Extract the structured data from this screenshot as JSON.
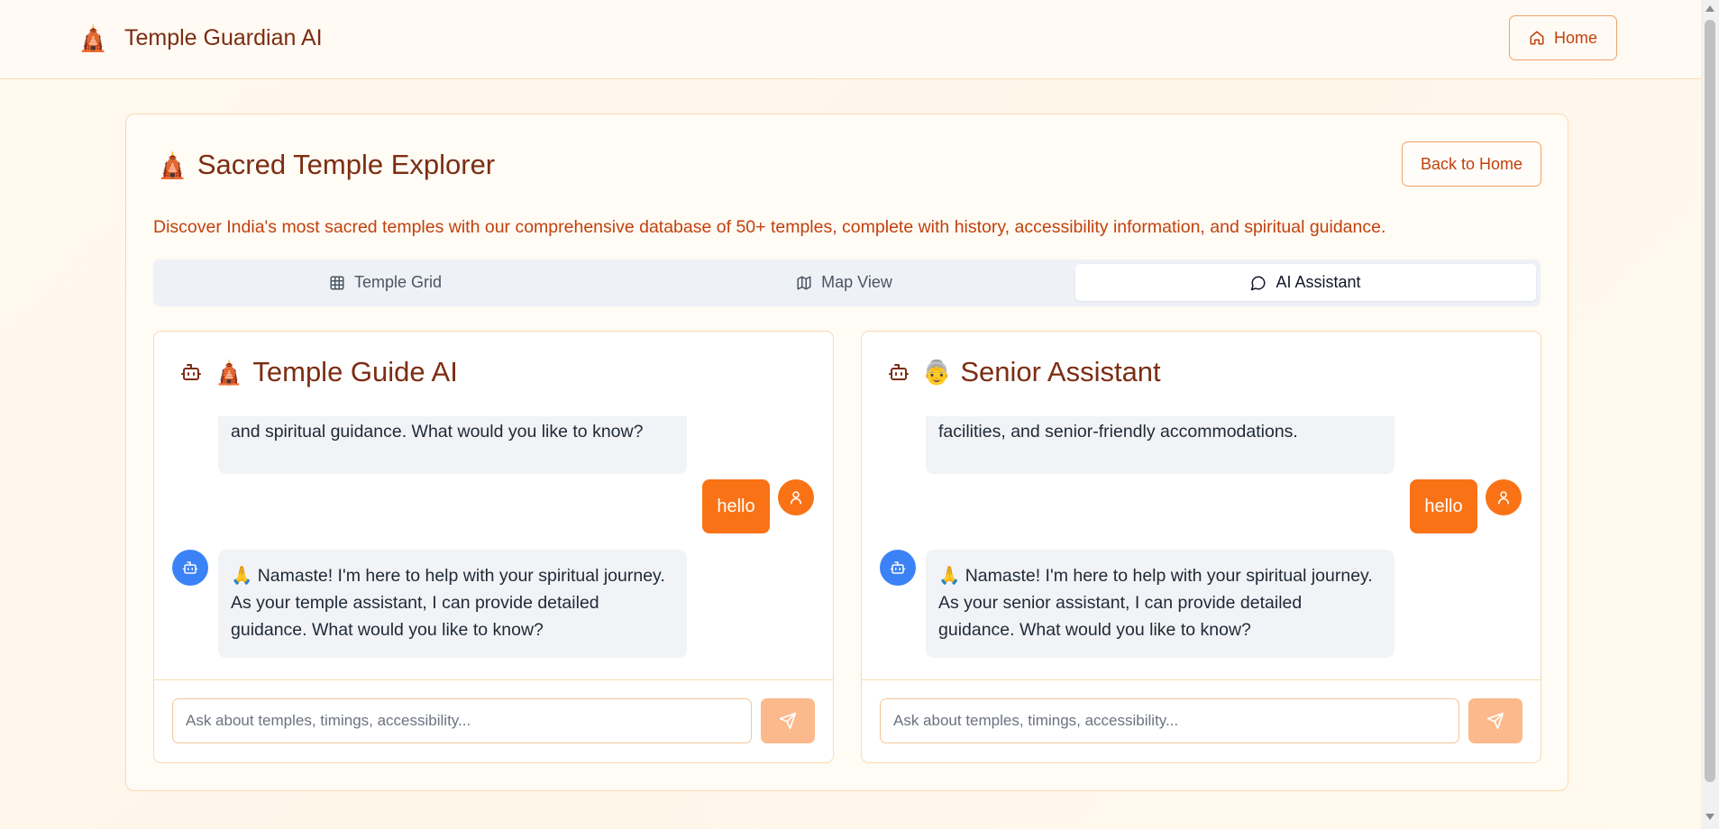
{
  "header": {
    "logo_emoji": "🛕",
    "app_title": "Temple Guardian AI",
    "home_label": "Home"
  },
  "explorer": {
    "title_emoji": "🛕",
    "title": "Sacred Temple Explorer",
    "back_label": "Back to Home",
    "subtitle": "Discover India's most sacred temples with our comprehensive database of 50+ temples, complete with history, accessibility information, and spiritual guidance."
  },
  "tabs": [
    {
      "label": "Temple Grid",
      "icon": "grid-icon",
      "active": false
    },
    {
      "label": "Map View",
      "icon": "map-icon",
      "active": false
    },
    {
      "label": "AI Assistant",
      "icon": "chat-bubble-icon",
      "active": true
    }
  ],
  "panels": [
    {
      "title_emoji": "🛕",
      "title": "Temple Guide AI",
      "prev_message_tail": "and spiritual guidance. What would you like to know?",
      "user_message": "hello",
      "ai_reply": "🙏 Namaste! I'm here to help with your spiritual journey. As your temple assistant, I can provide detailed guidance. What would you like to know?",
      "input_placeholder": "Ask about temples, timings, accessibility..."
    },
    {
      "title_emoji": "👵",
      "title": "Senior Assistant",
      "prev_message_tail": "facilities, and senior-friendly accommodations.",
      "user_message": "hello",
      "ai_reply": "🙏 Namaste! I'm here to help with your spiritual journey. As your senior assistant, I can provide detailed guidance. What would you like to know?",
      "input_placeholder": "Ask about temples, timings, accessibility..."
    }
  ],
  "colors": {
    "accent": "#f97316",
    "title_brown": "#7c2d12",
    "subtitle_orange": "#c2410c",
    "bot_blue": "#3b82f6"
  }
}
